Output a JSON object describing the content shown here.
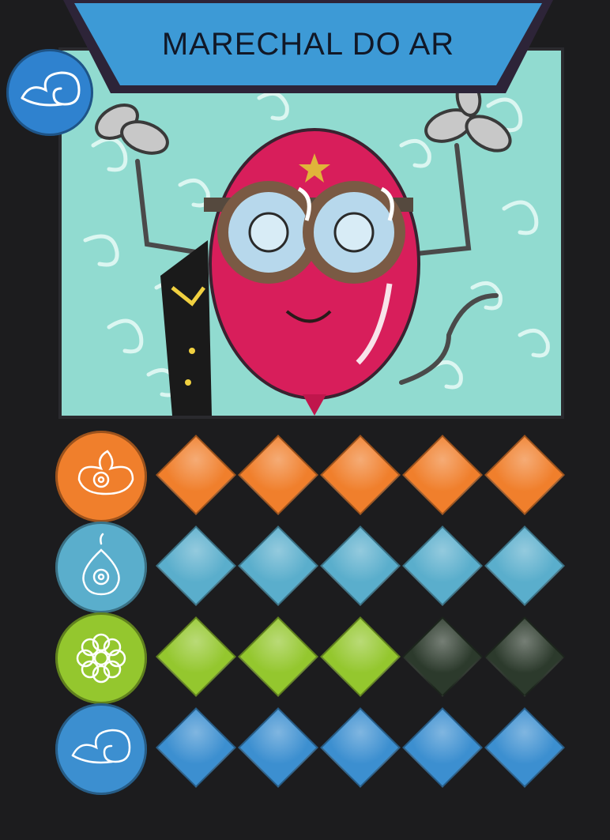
{
  "card": {
    "title": "MARECHAL DO AR",
    "element": "air",
    "element_icon": "air-swirl-icon"
  },
  "colors": {
    "background": "#1c1c1e",
    "banner": "#3d9ad6",
    "banner_border": "#2d2438",
    "sky": "#8fdcd0",
    "balloon": "#d81e5b"
  },
  "stats": [
    {
      "name": "fire",
      "icon": "fire-flower-icon",
      "color": "#f07f2c",
      "filled": 5,
      "max": 5
    },
    {
      "name": "water",
      "icon": "water-drop-icon",
      "color": "#5aaecc",
      "filled": 5,
      "max": 5
    },
    {
      "name": "earth",
      "icon": "earth-flower-icon",
      "color": "#94c72e",
      "filled": 3,
      "max": 5
    },
    {
      "name": "air",
      "icon": "air-swirl-icon",
      "color": "#3c8fd0",
      "filled": 5,
      "max": 5
    }
  ]
}
